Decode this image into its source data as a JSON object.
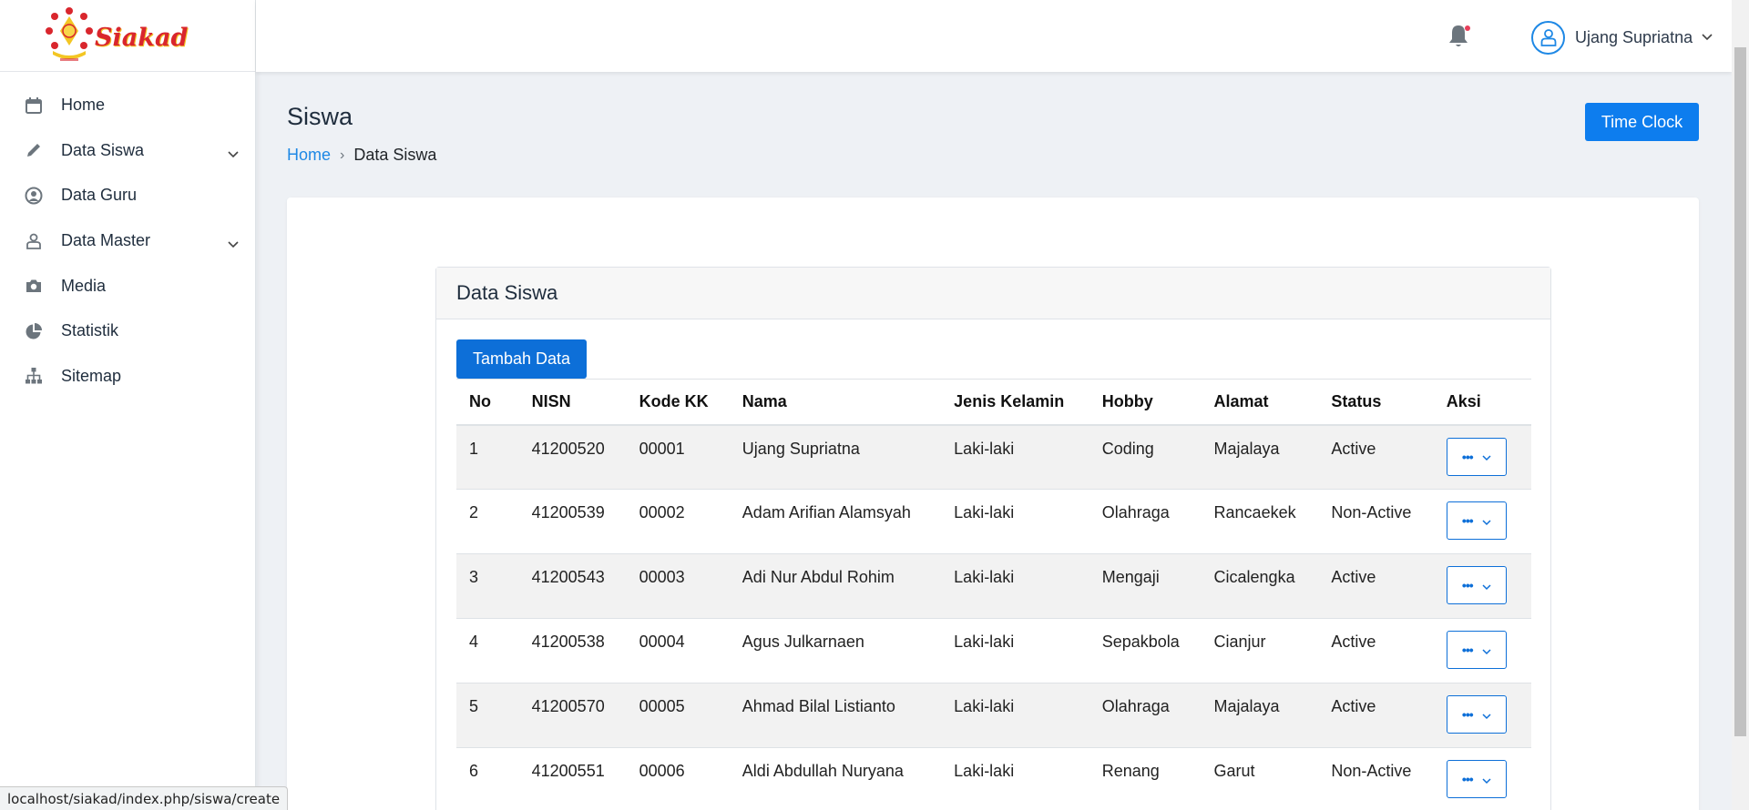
{
  "brand": {
    "logo_text": "Siakad"
  },
  "sidebar": {
    "items": [
      {
        "label": "Home",
        "icon": "calendar-icon",
        "has_submenu": false
      },
      {
        "label": "Data Siswa",
        "icon": "pencil-icon",
        "has_submenu": true
      },
      {
        "label": "Data Guru",
        "icon": "user-circle-icon",
        "has_submenu": false
      },
      {
        "label": "Data Master",
        "icon": "user-outline-icon",
        "has_submenu": true
      },
      {
        "label": "Media",
        "icon": "camera-icon",
        "has_submenu": false
      },
      {
        "label": "Statistik",
        "icon": "pie-chart-icon",
        "has_submenu": false
      },
      {
        "label": "Sitemap",
        "icon": "sitemap-icon",
        "has_submenu": false
      }
    ]
  },
  "topbar": {
    "user_name": "Ujang Supriatna",
    "notification_dot": true
  },
  "page": {
    "title": "Siswa",
    "breadcrumb": {
      "home": "Home",
      "current": "Data Siswa"
    },
    "time_clock_label": "Time Clock"
  },
  "card": {
    "title": "Data Siswa",
    "add_button": "Tambah Data"
  },
  "table": {
    "headers": [
      "No",
      "NISN",
      "Kode KK",
      "Nama",
      "Jenis Kelamin",
      "Hobby",
      "Alamat",
      "Status",
      "Aksi"
    ],
    "rows": [
      [
        "1",
        "41200520",
        "00001",
        "Ujang Supriatna",
        "Laki-laki",
        "Coding",
        "Majalaya",
        "Active"
      ],
      [
        "2",
        "41200539",
        "00002",
        "Adam Arifian Alamsyah",
        "Laki-laki",
        "Olahraga",
        "Rancaekek",
        "Non-Active"
      ],
      [
        "3",
        "41200543",
        "00003",
        "Adi Nur Abdul Rohim",
        "Laki-laki",
        "Mengaji",
        "Cicalengka",
        "Active"
      ],
      [
        "4",
        "41200538",
        "00004",
        "Agus Julkarnaen",
        "Laki-laki",
        "Sepakbola",
        "Cianjur",
        "Active"
      ],
      [
        "5",
        "41200570",
        "00005",
        "Ahmad Bilal Listianto",
        "Laki-laki",
        "Olahraga",
        "Majalaya",
        "Active"
      ],
      [
        "6",
        "41200551",
        "00006",
        "Aldi Abdullah Nuryana",
        "Laki-laki",
        "Renang",
        "Garut",
        "Non-Active"
      ]
    ],
    "action_icon": "more-dots-icon"
  },
  "statusbar": {
    "url": "localhost/siakad/index.php/siswa/create"
  },
  "colors": {
    "primary": "#0d6fd8",
    "link": "#1e88e5",
    "logo_red": "#d9262d",
    "logo_yellow": "#f3c623"
  }
}
